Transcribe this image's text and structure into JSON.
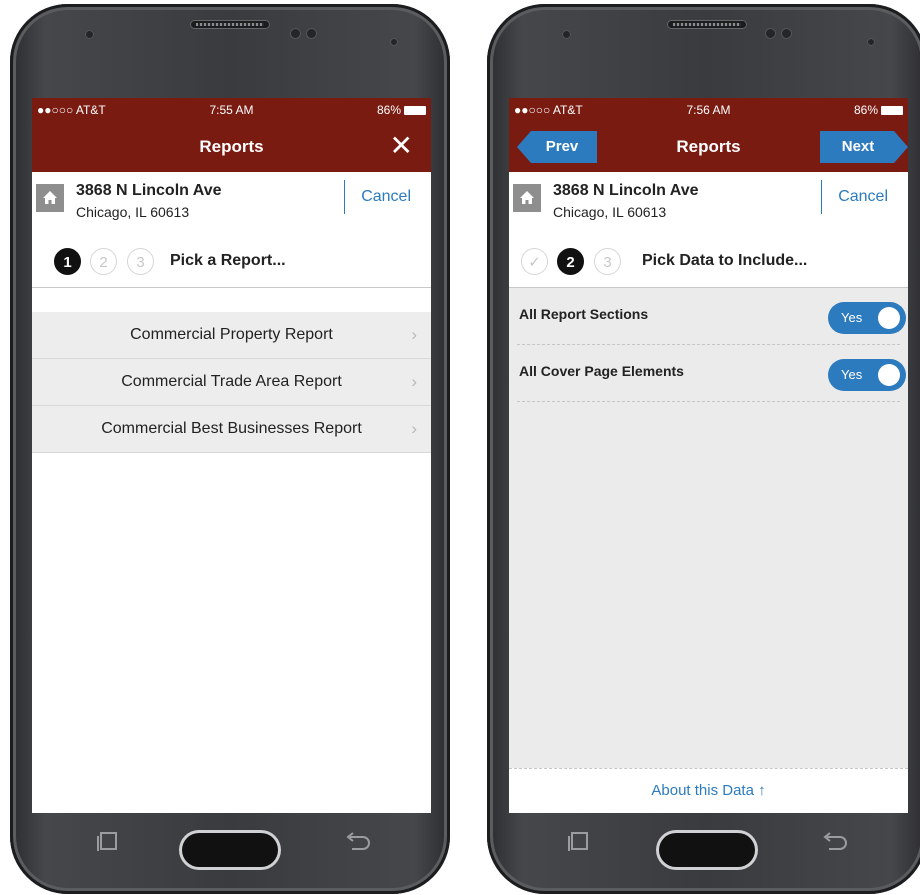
{
  "left_phone": {
    "status": {
      "carrier": "●●○○○ AT&T",
      "time": "7:55 AM",
      "battery": "86%"
    },
    "nav": {
      "title": "Reports",
      "close_icon": "close-icon"
    },
    "address": {
      "line1": "3868 N Lincoln Ave",
      "line2": "Chicago, IL 60613",
      "cancel": "Cancel"
    },
    "steps": {
      "labels": [
        "1",
        "2",
        "3"
      ],
      "prompt": "Pick a Report..."
    },
    "reports": [
      {
        "label": "Commercial Property Report"
      },
      {
        "label": "Commercial Trade Area Report"
      },
      {
        "label": "Commercial Best Businesses Report"
      }
    ]
  },
  "right_phone": {
    "status": {
      "carrier": "●●○○○ AT&T",
      "time": "7:56 AM",
      "battery": "86%"
    },
    "nav": {
      "title": "Reports",
      "prev": "Prev",
      "next": "Next"
    },
    "address": {
      "line1": "3868 N Lincoln Ave",
      "line2": "Chicago, IL 60613",
      "cancel": "Cancel"
    },
    "steps": {
      "labels": [
        "✓",
        "2",
        "3"
      ],
      "prompt": "Pick Data to Include..."
    },
    "options": [
      {
        "label": "All Report Sections",
        "value": "Yes"
      },
      {
        "label": "All Cover Page Elements",
        "value": "Yes"
      }
    ],
    "about": "About this Data ↑"
  },
  "colors": {
    "nav_bar": "#7a1b12",
    "accent": "#2c7bbf",
    "list_bg": "#ededed"
  }
}
